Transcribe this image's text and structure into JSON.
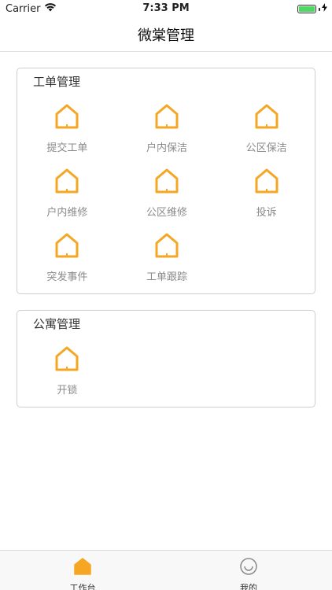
{
  "status_bar": {
    "carrier": "Carrier",
    "time": "7:33 PM",
    "battery_level": 1.0
  },
  "nav": {
    "title": "微棠管理"
  },
  "colors": {
    "accent": "#F5A623",
    "label_gray": "#8a8a8a",
    "battery_green": "#4cd964"
  },
  "sections": [
    {
      "title": "工单管理",
      "items": [
        {
          "label": "提交工单",
          "icon": "house-icon"
        },
        {
          "label": "户内保洁",
          "icon": "house-icon"
        },
        {
          "label": "公区保洁",
          "icon": "house-icon"
        },
        {
          "label": "户内维修",
          "icon": "house-icon"
        },
        {
          "label": "公区维修",
          "icon": "house-icon"
        },
        {
          "label": "投诉",
          "icon": "house-icon"
        },
        {
          "label": "突发事件",
          "icon": "house-icon"
        },
        {
          "label": "工单跟踪",
          "icon": "house-icon"
        }
      ]
    },
    {
      "title": "公寓管理",
      "items": [
        {
          "label": "开锁",
          "icon": "house-icon"
        }
      ]
    }
  ],
  "tab_bar": {
    "tabs": [
      {
        "label": "工作台",
        "icon": "home-filled-icon",
        "active": true
      },
      {
        "label": "我的",
        "icon": "smiley-icon",
        "active": false
      }
    ]
  }
}
